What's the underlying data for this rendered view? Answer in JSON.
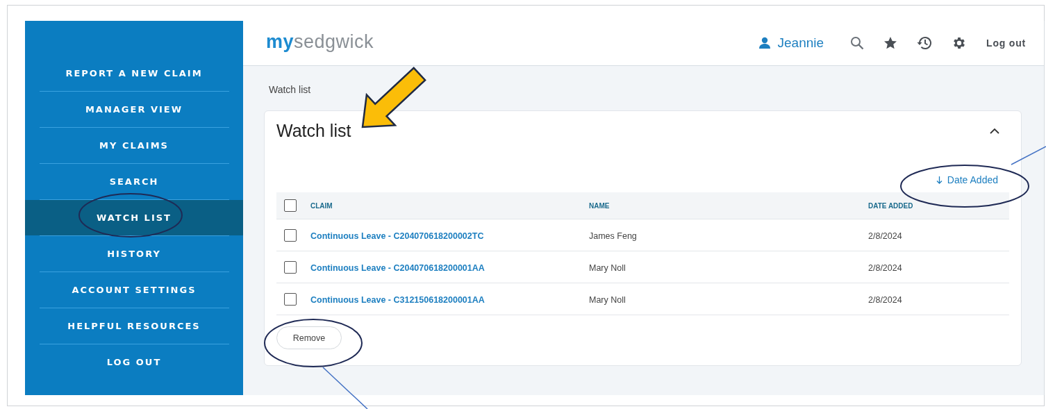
{
  "sidebar": {
    "items": [
      {
        "label": "REPORT A NEW CLAIM",
        "selected": false
      },
      {
        "label": "MANAGER VIEW",
        "selected": false
      },
      {
        "label": "MY CLAIMS",
        "selected": false
      },
      {
        "label": "SEARCH",
        "selected": false
      },
      {
        "label": "WATCH LIST",
        "selected": true
      },
      {
        "label": "HISTORY",
        "selected": false
      },
      {
        "label": "ACCOUNT SETTINGS",
        "selected": false
      },
      {
        "label": "HELPFUL RESOURCES",
        "selected": false
      },
      {
        "label": "LOG OUT",
        "selected": false
      }
    ]
  },
  "header": {
    "logo": {
      "prefix": "my",
      "name": "sedgwick"
    },
    "user": "Jeannie",
    "logout": "Log out"
  },
  "breadcrumb": "Watch list",
  "card": {
    "title": "Watch list",
    "expanded": true,
    "sort": "Date Added",
    "table": {
      "columns": [
        "CLAIM",
        "NAME",
        "DATE ADDED"
      ],
      "all_checked": false,
      "rows": [
        {
          "claim": "Continuous Leave - C204070618200002TC",
          "name": "James Feng",
          "date": "2/8/2024",
          "checked": false
        },
        {
          "claim": "Continuous Leave - C204070618200001AA",
          "name": "Mary Noll",
          "date": "2/8/2024",
          "checked": false
        },
        {
          "claim": "Continuous Leave - C312150618200001AA",
          "name": "Mary Noll",
          "date": "2/8/2024",
          "checked": false
        }
      ]
    },
    "remove": "Remove"
  }
}
